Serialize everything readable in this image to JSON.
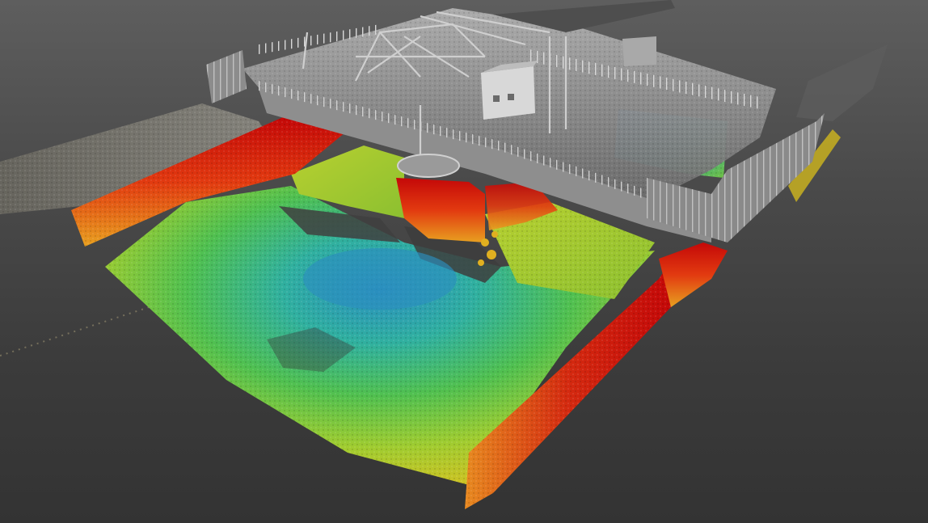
{
  "scene": {
    "subject": "point-cloud-render",
    "colors": {
      "background_top": "#5e5e5e",
      "background_bottom": "#333333",
      "structure_gray": "#9a9a9a",
      "depth_red": "#d01010",
      "depth_orange": "#e87010",
      "depth_yellow": "#d8d020",
      "depth_green": "#60c040",
      "depth_cyan": "#30b0a0",
      "depth_blue": "#2080c0"
    }
  }
}
